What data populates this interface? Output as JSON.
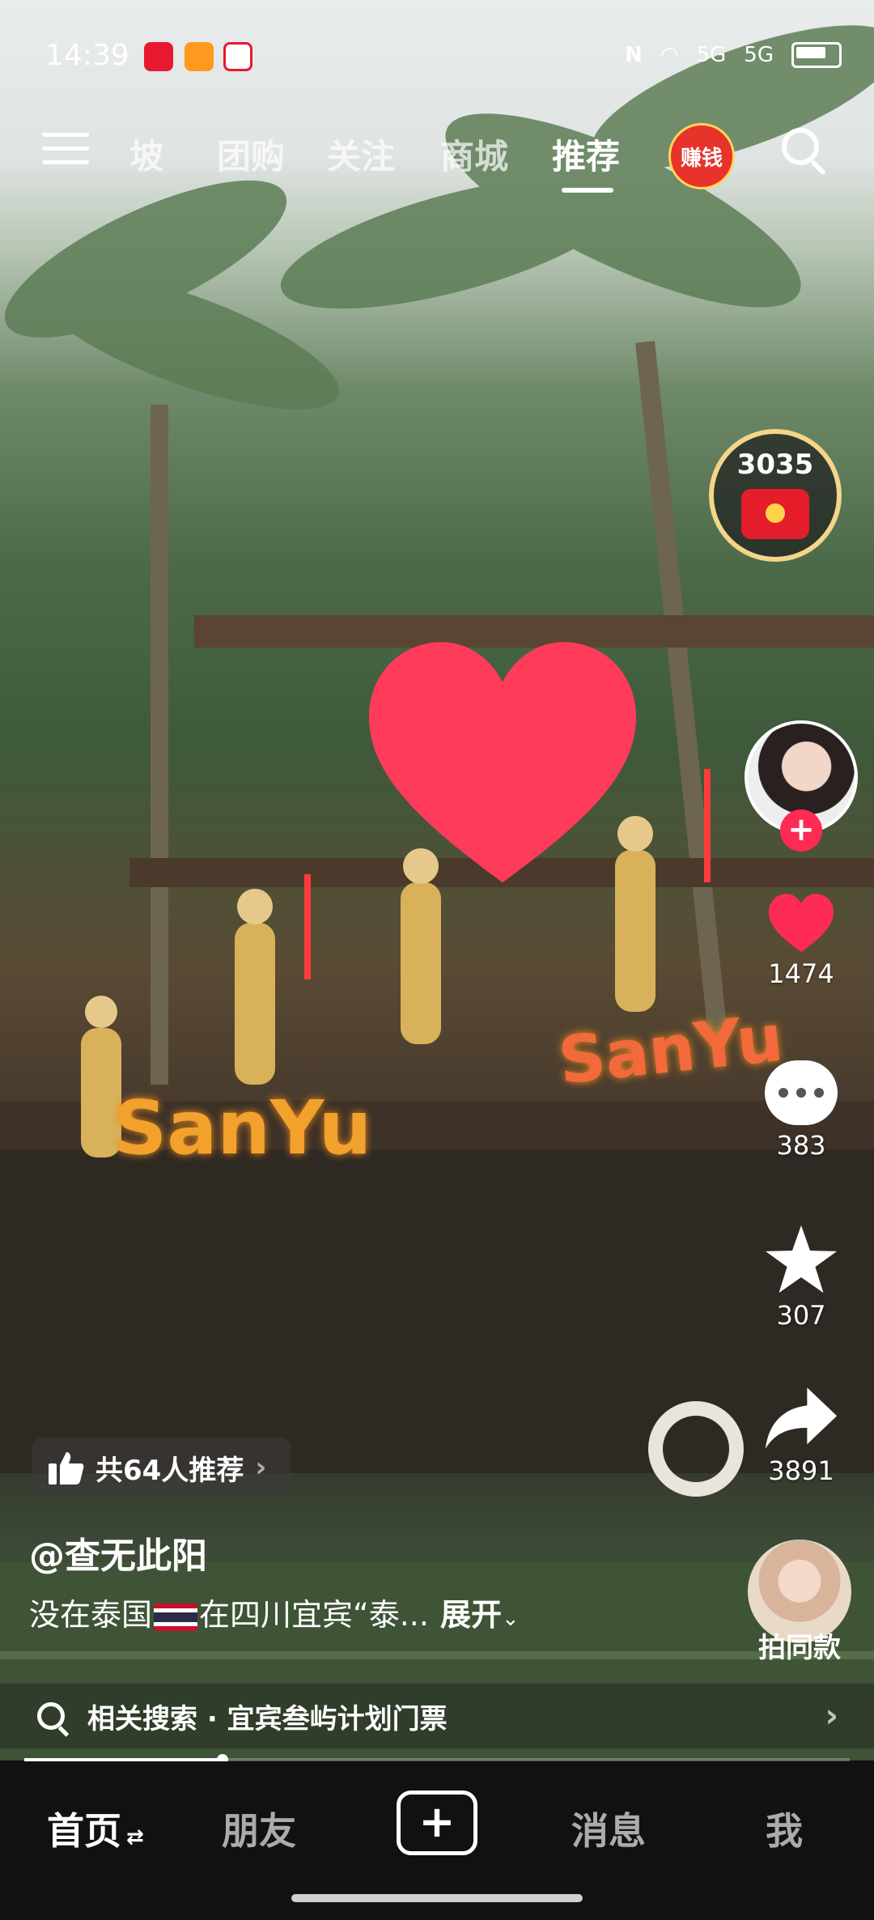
{
  "status_bar": {
    "time": "14:39",
    "nfc": "N",
    "signal_1": "5G",
    "signal_2": "5G"
  },
  "top_tabs": [
    {
      "label": "坡"
    },
    {
      "label": "团购"
    },
    {
      "label": "关注"
    },
    {
      "label": "商城"
    },
    {
      "label": "推荐"
    }
  ],
  "earn_badge": "赚钱",
  "scene_signs": {
    "left": "SanYu",
    "right": "SanYu"
  },
  "coin_reward": {
    "count": "3035"
  },
  "actions": {
    "likes": "1474",
    "comments": "383",
    "favorites": "307",
    "shares": "3891"
  },
  "recommend_pill": {
    "text": "共64人推荐",
    "chevron": "›"
  },
  "author": "@查无此阳",
  "description": {
    "before_flag": "没在泰国",
    "after_flag": "在四川宜宾“泰...",
    "expand": "展开"
  },
  "shoot_same": {
    "label": "拍同款"
  },
  "related_search": {
    "text": "相关搜索 · 宜宾叁屿计划门票",
    "chevron": "›"
  },
  "playback_progress": 0.24,
  "bottom_nav": {
    "home": "首页",
    "friends": "朋友",
    "create": "+",
    "messages": "消息",
    "me": "我"
  }
}
